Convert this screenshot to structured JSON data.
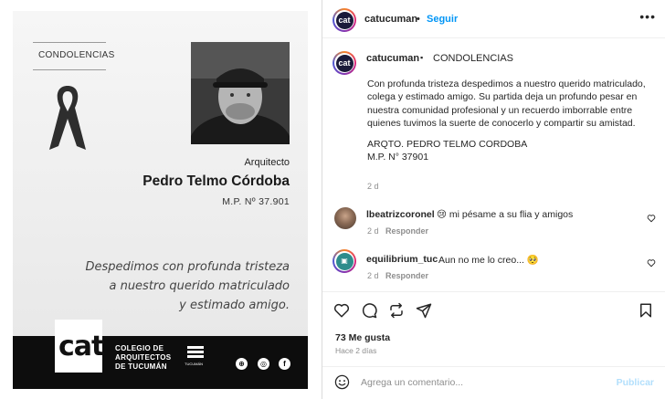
{
  "post_image": {
    "tag": "CONDOLENCIAS",
    "role": "Arquitecto",
    "name": "Pedro Telmo Córdoba",
    "mp": "M.P. Nº 37.901",
    "farewell": [
      "Despedimos con profunda tristeza",
      "a nuestro querido matriculado",
      "y estimado amigo."
    ],
    "logo": "cat",
    "org_lines": [
      "COLEGIO DE",
      "ARQUITECTOS",
      "DE TUCUMÁN"
    ],
    "mini_logo_label": "TUCUMÁN",
    "social_icons": [
      "globe-icon",
      "instagram-icon",
      "facebook-icon"
    ]
  },
  "header": {
    "avatar_text": "cat",
    "username": "catucuman",
    "separator": "•",
    "follow_label": "Seguir",
    "more_label": "•••"
  },
  "caption": {
    "avatar_text": "cat",
    "username": "catucuman",
    "bullet": "▪",
    "title": "CONDOLENCIAS",
    "body": "Con profunda tristeza despedimos a nuestro querido matriculado, colega y estimado amigo. Su partida deja un profundo pesar en nuestra comunidad profesional y un recuerdo imborrable entre quienes tuvimos la suerte de conocerlo y compartir su amistad.",
    "signature_1": "ARQTO. PEDRO TELMO CORDOBA",
    "signature_2": "M.P. N° 37901",
    "time": "2 d"
  },
  "comments": [
    {
      "username": "lbeatrizcoronel",
      "text": "😢 mi pésame a su flia y amigos",
      "time": "2 d",
      "reply_label": "Responder"
    },
    {
      "username": "equilibrium_tuc",
      "text": "Aun no me lo creo... 🥺",
      "time": "2 d",
      "reply_label": "Responder"
    }
  ],
  "actions": [
    "heart-icon",
    "comment-icon",
    "share-icon",
    "repost-icon",
    "bookmark-icon"
  ],
  "likes": "73 Me gusta",
  "posted": "Hace 2 días",
  "comment_box": {
    "placeholder": "Agrega un comentario...",
    "publish_label": "Publicar"
  },
  "colors": {
    "link_blue": "#0095f6",
    "publish_disabled": "#b2dffc",
    "muted": "#8e8e8e",
    "footer_black": "#0d0d0d"
  }
}
